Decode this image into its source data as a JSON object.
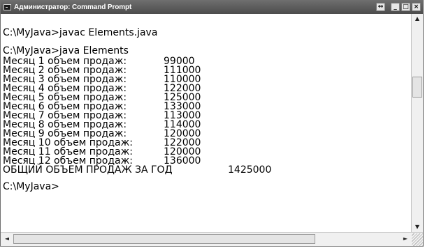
{
  "window": {
    "title": "Администратор: Command Prompt",
    "buttons": {
      "resize": "↔",
      "minimize": "_",
      "maximize": "□",
      "close": "×"
    }
  },
  "console": {
    "cmd1": "C:\\MyJava>javac Elements.java",
    "cmd2": "C:\\MyJava>java Elements",
    "rows": [
      {
        "label": "Месяц 1 объем продаж:",
        "value": "99000"
      },
      {
        "label": "Месяц 2 объем продаж:",
        "value": "111000"
      },
      {
        "label": "Месяц 3 объем продаж:",
        "value": "110000"
      },
      {
        "label": "Месяц 4 объем продаж:",
        "value": "122000"
      },
      {
        "label": "Месяц 5 объем продаж:",
        "value": "125000"
      },
      {
        "label": "Месяц 6 объем продаж:",
        "value": "133000"
      },
      {
        "label": "Месяц 7 объем продаж:",
        "value": "113000"
      },
      {
        "label": "Месяц 8 объем продаж:",
        "value": "114000"
      },
      {
        "label": "Месяц 9 объем продаж:",
        "value": "120000"
      },
      {
        "label": "Месяц 10 объем продаж:",
        "value": "122000"
      },
      {
        "label": "Месяц 11 объем продаж:",
        "value": "120000"
      },
      {
        "label": "Месяц 12 объем продаж:",
        "value": "136000"
      }
    ],
    "total_label": "ОБЩИЙ ОБЪЕМ ПРОДАЖ ЗА ГОД",
    "total_value": "1425000",
    "prompt": "C:\\MyJava>"
  },
  "scrollbars": {
    "up": "▲",
    "down": "▼",
    "left": "◄",
    "right": "►"
  }
}
